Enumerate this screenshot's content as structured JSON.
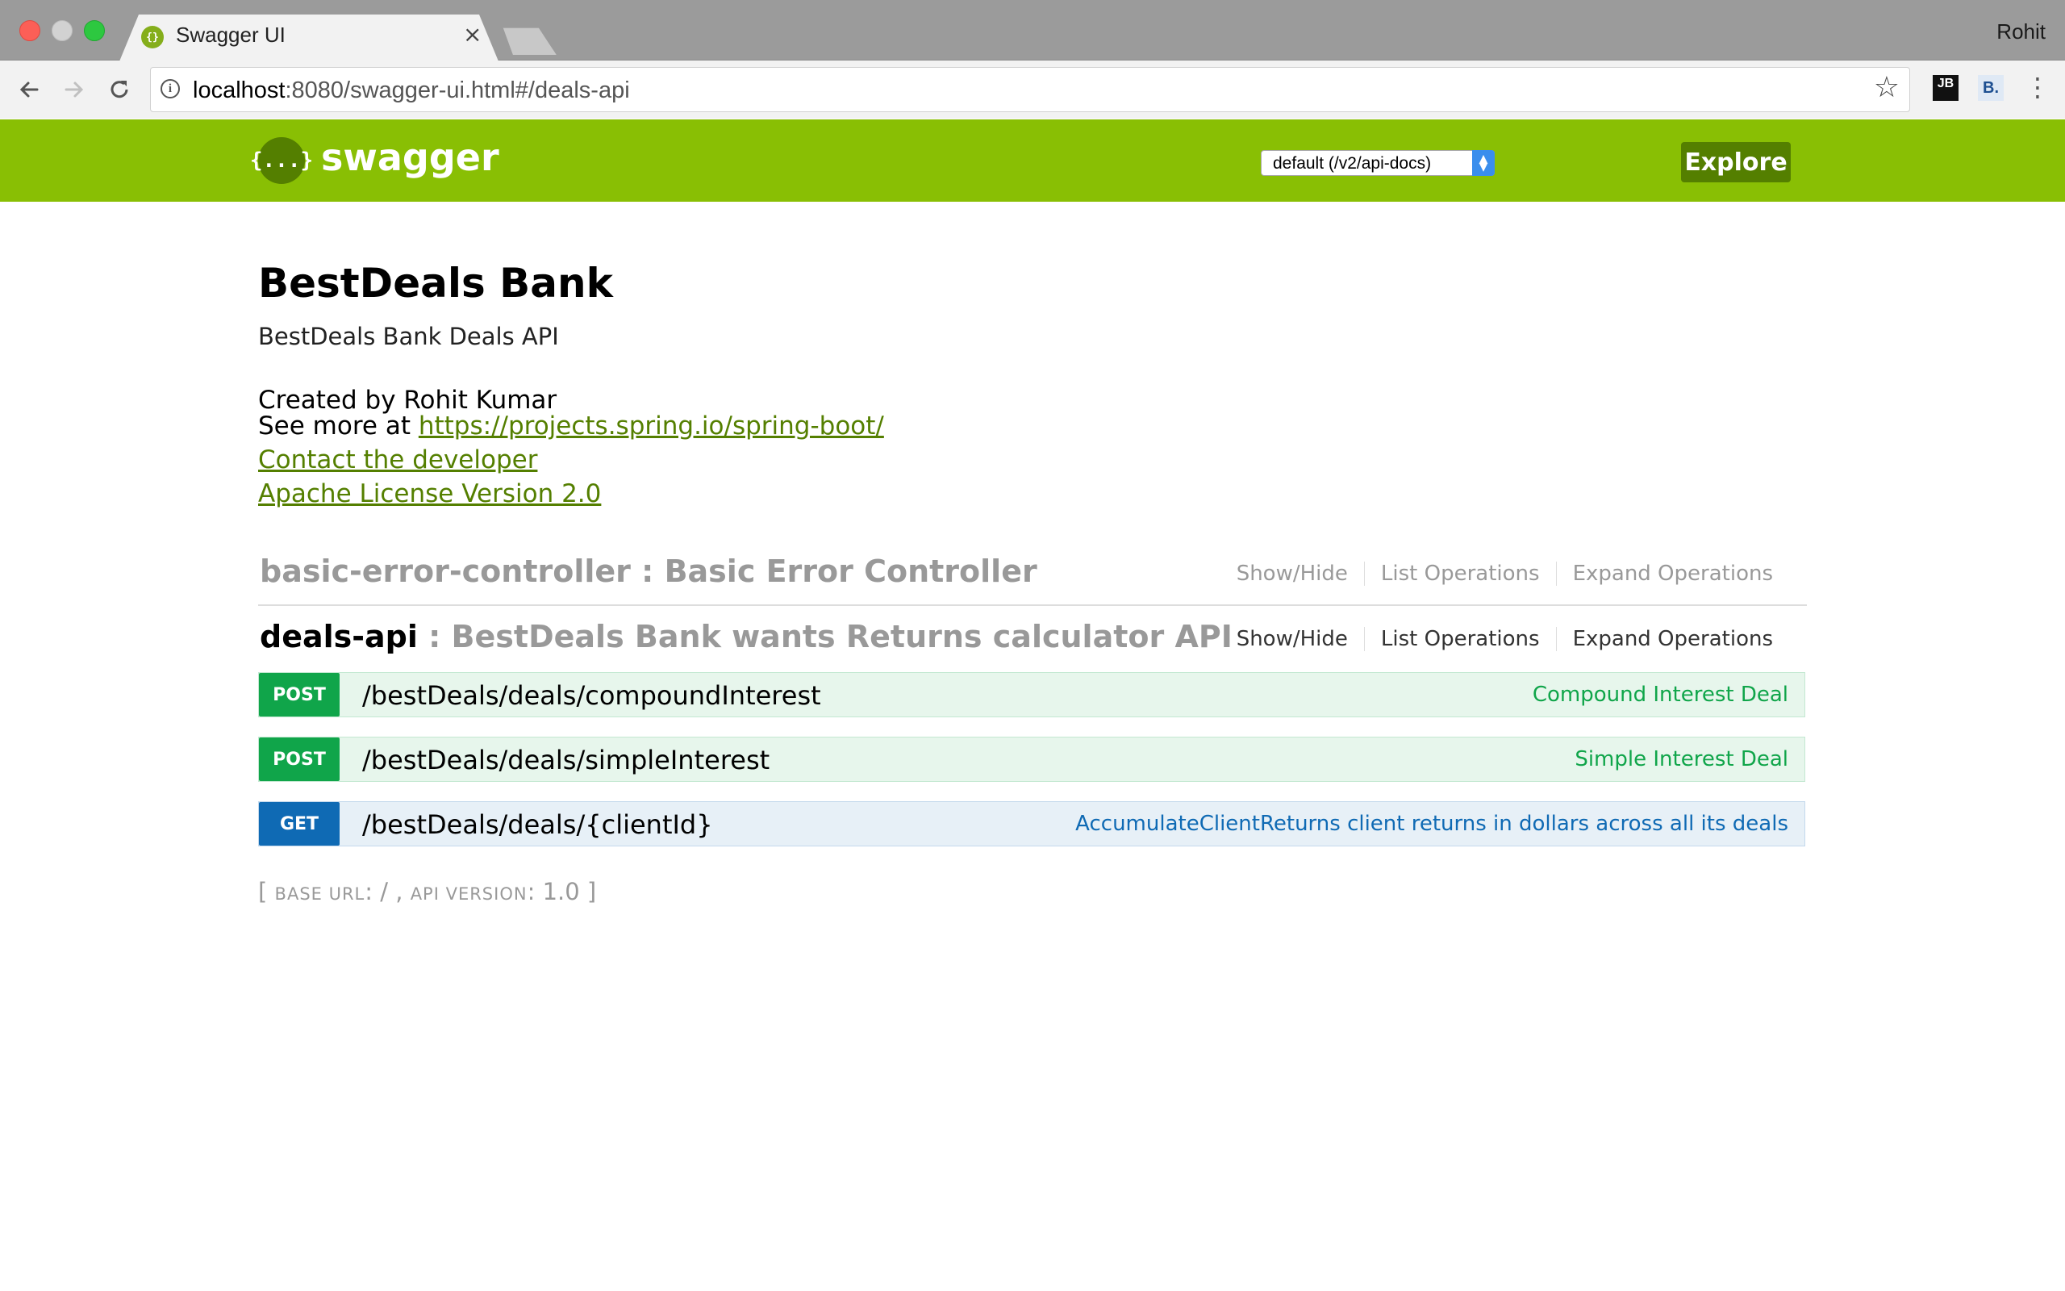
{
  "browser": {
    "tab_title": "Swagger UI",
    "tab_close": "×",
    "profile_name": "Rohit",
    "url_host": "localhost",
    "url_rest": ":8080/swagger-ui.html#/deals-api",
    "icons": [
      "back-arrow-icon",
      "forward-arrow-icon",
      "reload-icon",
      "info-icon",
      "star-icon",
      "jetbrains-extension-icon",
      "b-extension-icon",
      "menu-dots-icon"
    ],
    "ext_jb": "JB",
    "ext_b": "B."
  },
  "header": {
    "logo_text": "swagger",
    "logo_glyph": "{...}",
    "spec_selected": "default (/v2/api-docs)",
    "explore_label": "Explore",
    "brand_color": "#89bf04"
  },
  "info": {
    "title": "BestDeals Bank",
    "description": "BestDeals Bank Deals API",
    "created_by": "Created by Rohit Kumar",
    "see_more_prefix": "See more at ",
    "see_more_link": "https://projects.spring.io/spring-boot/",
    "contact": "Contact the developer",
    "license": "Apache License Version 2.0"
  },
  "resources": [
    {
      "name": "basic-error-controller",
      "description": " : Basic Error Controller",
      "actions": [
        "Show/Hide",
        "List Operations",
        "Expand Operations"
      ]
    },
    {
      "name": "deals-api",
      "description": " : BestDeals Bank wants Returns calculator API",
      "actions": [
        "Show/Hide",
        "List Operations",
        "Expand Operations"
      ],
      "operations": [
        {
          "method": "POST",
          "path": "/bestDeals/deals/compoundInterest",
          "summary": "Compound Interest Deal"
        },
        {
          "method": "POST",
          "path": "/bestDeals/deals/simpleInterest",
          "summary": "Simple Interest Deal"
        },
        {
          "method": "GET",
          "path": "/bestDeals/deals/{clientId}",
          "summary": "AccumulateClientReturns client returns in dollars across all its deals"
        }
      ]
    }
  ],
  "footer": {
    "open": "[ ",
    "base_url_label": "BASE URL",
    "base_url_value": ": / , ",
    "api_version_label": "API VERSION",
    "api_version_value": ": 1.0 ]"
  }
}
